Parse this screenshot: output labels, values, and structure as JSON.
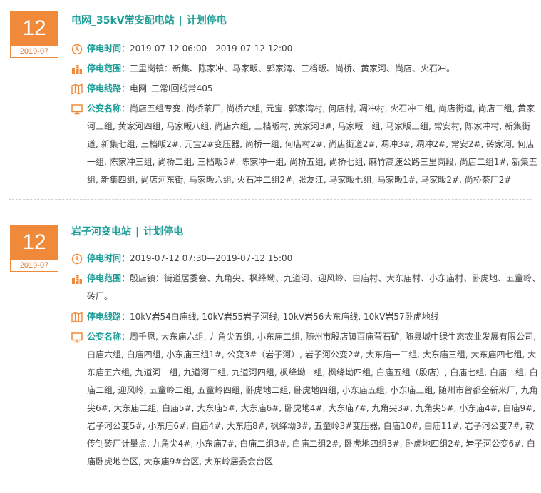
{
  "notices": [
    {
      "day": "12",
      "month": "2019-07",
      "station": "电网_35kV常安配电站",
      "separator": "|",
      "type": "计划停电",
      "time_label": "停电时间：",
      "time_value": "2019-07-12 06:00—2019-07-12 12:00",
      "range_label": "停电范围：",
      "range_value": "三里岗镇：新集、陈家冲、马家畈、郭家湾、三档畈、尚桥、黄家河、尚店、火石冲。",
      "line_label": "停电线路：",
      "line_value": "电网_三常Ⅰ回线常405",
      "transformer_label": "公变名称：",
      "transformer_value": "尚店五组专变, 尚桥茶厂, 尚桥六组, 元宝, 郭家湾村, 何店村, 凋冲村, 火石冲二组, 尚店街道, 尚店二组, 黄家河三组, 黄家河四组, 马家畈八组, 尚店六组, 三档畈村, 黄家河3#, 马家畈一组, 马家畈三组, 常安村, 陈家冲村, 新集街道, 新集七组, 三档畈2#, 元宝2#变压器, 尚桥一组, 何店村2#, 尚店街道2#, 凋冲3#, 凋冲2#, 常安2#, 砖家河, 何店一组, 陈家冲三组, 尚桥二组, 三档畈3#, 陈家冲一组, 尚桥五组, 尚桥七组, 麻竹高速公路三里岗段, 尚店二组1#, 新集五组, 新集四组, 尚店河东街, 马家畈六组, 火石冲二组2#, 张友江, 马家畈七组, 马家畈1#, 马家畈2#, 尚桥茶厂2#"
    },
    {
      "day": "12",
      "month": "2019-07",
      "station": "岩子河变电站",
      "separator": "|",
      "type": "计划停电",
      "time_label": "停电时间：",
      "time_value": "2019-07-12 07:30—2019-07-12 15:00",
      "range_label": "停电范围：",
      "range_value": "殷店镇：街道居委会、九角尖、枫绛坳、九道河、迎风岭、白庙村、大东庙村、小东庙村、卧虎地、五童岭、砖厂。",
      "line_label": "停电线路：",
      "line_value": "10kV岩54白庙线, 10kV岩55岩子河线, 10kV岩56大东庙线, 10kV岩57卧虎地线",
      "transformer_label": "公变名称：",
      "transformer_value": "周千恩, 大东庙六组, 九角尖五组, 小东庙二组, 随州市殷店镇百庙萤石矿, 随县城中绿生态农业发展有限公司, 白庙六组, 白庙四组, 小东庙三组1#, 公变3#（岩子河）, 岩子河公变2#, 大东庙一二组, 大东庙三组, 大东庙四七组, 大东庙五六组, 九道河一组, 九道河二组, 九道河四组, 枫绛坳一组, 枫绛坳四组, 白庙五组（殷店）, 白庙七组, 白庙一组, 白庙二组, 迎风岭, 五童岭二组, 五童岭四组, 卧虎地二组, 卧虎地四组, 小东庙五组, 小东庙三组, 随州市曾都全新米厂, 九角尖6#, 大东庙二组, 白庙5#, 大东庙5#, 大东庙6#, 卧虎地4#, 大东庙7#, 九角尖3#, 九角尖5#, 小东庙4#, 白庙9#, 岩子河公变5#, 小东庙6#, 白庙4#, 大东庙8#, 枫绛坳3#, 五童岭3#变压器, 白庙10#, 白庙11#, 岩子河公变7#, 软传钊砖厂计量点, 九角尖4#, 小东庙7#, 白庙二组3#, 白庙二组2#, 卧虎地四组3#, 卧虎地四组2#, 岩子河公变6#, 白庙卧虎地台区, 大东庙9#台区, 大东岭居委会台区"
    }
  ],
  "icons": {
    "time": "clock-icon",
    "range": "buildings-icon",
    "line": "map-icon",
    "transformer": "monitor-icon",
    "icon_color": "#f08a3a"
  },
  "colors": {
    "accent_orange": "#f08a3a",
    "title_teal": "#1e9e97",
    "divider": "#cfcfcf"
  }
}
